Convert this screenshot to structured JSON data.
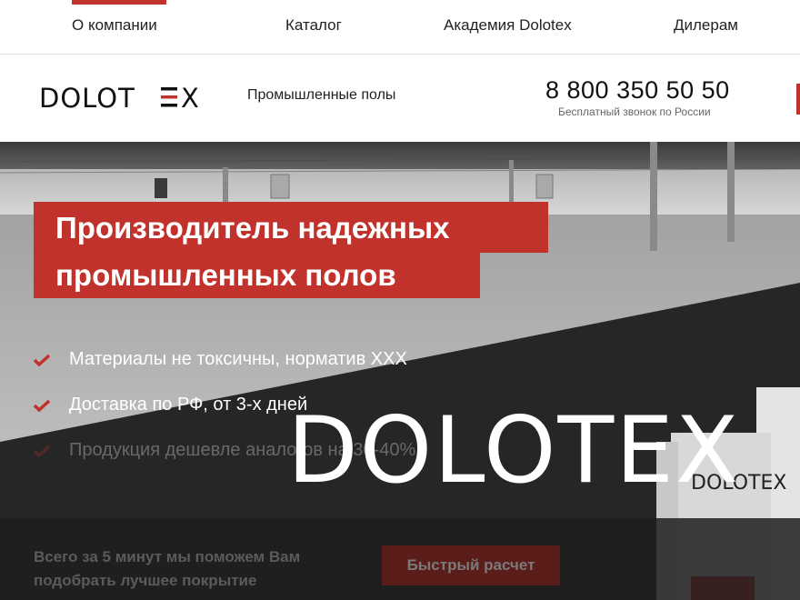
{
  "topnav": {
    "items": [
      "О компании",
      "Каталог",
      "Академия Dolotex",
      "Дилерам"
    ],
    "active_index": 0
  },
  "header": {
    "logo_text": "DOLOTEX",
    "tagline": "Промышленные полы",
    "phone": "8 800 350 50 50",
    "phone_note": "Бесплатный звонок по России"
  },
  "hero": {
    "headline_line1": "Производитель надежных",
    "headline_line2": "промышленных полов",
    "features": [
      "Материалы не токсичны, норматив XXX",
      "Доставка по РФ, от 3-х дней",
      "Продукция дешевле аналогов на 30-40%"
    ],
    "watermark": "DOLOTEX",
    "product_bag_label": "DOLOTEX"
  },
  "cta": {
    "text_line1": "Всего за 5 минут мы поможем Вам",
    "text_line2": "подобрать лучшее покрытие",
    "button_label": "Быстрый расчет"
  },
  "colors": {
    "accent": "#c0322b"
  }
}
